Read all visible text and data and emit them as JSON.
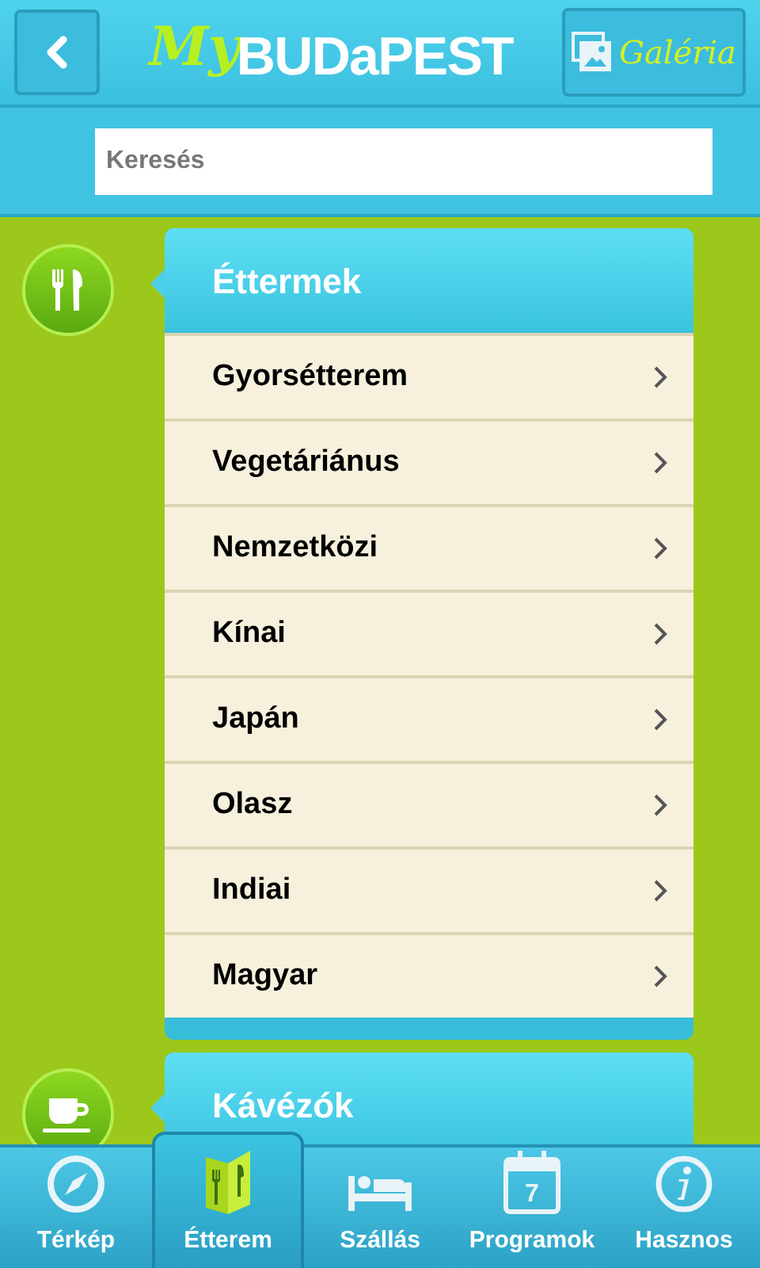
{
  "header": {
    "logo_script": "My",
    "logo_word": "BUDaPEST",
    "gallery_label": "Galéria"
  },
  "search": {
    "placeholder": "Keresés"
  },
  "sections": [
    {
      "kind": "restaurant",
      "title": "Éttermek",
      "expanded": true,
      "items": [
        "Gyorsétterem",
        "Vegetáriánus",
        "Nemzetközi",
        "Kínai",
        "Japán",
        "Olasz",
        "Indiai",
        "Magyar"
      ]
    },
    {
      "kind": "cafe",
      "title": "Kávézók",
      "expanded": false
    }
  ],
  "tabs": [
    {
      "kind": "map",
      "label": "Térkép",
      "selected": false
    },
    {
      "kind": "restaurant",
      "label": "Étterem",
      "selected": true
    },
    {
      "kind": "hotel",
      "label": "Szállás",
      "selected": false
    },
    {
      "kind": "calendar",
      "label": "Programok",
      "selected": false,
      "icon_text": "7"
    },
    {
      "kind": "info",
      "label": "Hasznos",
      "selected": false
    }
  ]
}
